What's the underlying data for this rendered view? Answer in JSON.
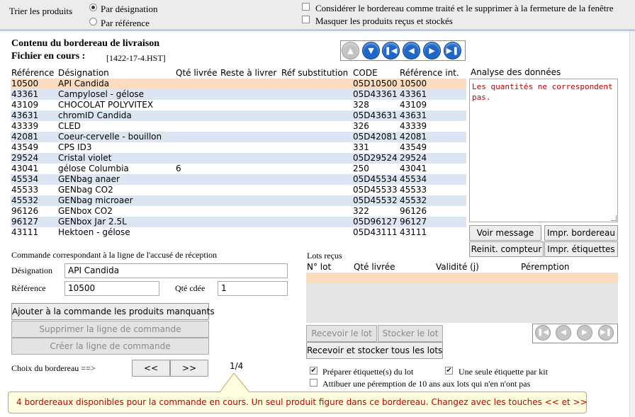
{
  "sort": {
    "label": "Trier les produits",
    "options": [
      {
        "label": "Par désignation",
        "selected": true
      },
      {
        "label": "Par référence",
        "selected": false
      }
    ]
  },
  "options": [
    {
      "label": "Considérer le bordereau comme traité et le supprimer à la fermeture de la fenêtre",
      "checked": false
    },
    {
      "label": "Masquer les produits reçus et stockés",
      "checked": false
    }
  ],
  "slip": {
    "title": "Contenu du bordereau de livraison",
    "file_label": "Fichier en cours :",
    "file_name": "[1422-17-4.HST]"
  },
  "grid": {
    "columns": [
      "Référence",
      "Désignation",
      "Qté livrée",
      "Reste à livrer",
      "Réf substitution",
      "CODE",
      "Référence int."
    ],
    "rows": [
      {
        "ref": "10500",
        "des": "API Candida",
        "qte": "",
        "rst": "",
        "sub": "",
        "code": "05D10500",
        "refi": "10500",
        "selected": true
      },
      {
        "ref": "43361",
        "des": "Campylosel - gélose",
        "qte": "",
        "rst": "",
        "sub": "",
        "code": "05D43361",
        "refi": "43361"
      },
      {
        "ref": "43109",
        "des": "CHOCOLAT POLYVITEX",
        "qte": "",
        "rst": "",
        "sub": "",
        "code": "328",
        "refi": "43109"
      },
      {
        "ref": "43631",
        "des": "chromID Candida",
        "qte": "",
        "rst": "",
        "sub": "",
        "code": "05D43631",
        "refi": "43631"
      },
      {
        "ref": "43339",
        "des": "CLED",
        "qte": "",
        "rst": "",
        "sub": "",
        "code": "326",
        "refi": "43339"
      },
      {
        "ref": "42081",
        "des": "Coeur-cervelle - bouillon",
        "qte": "",
        "rst": "",
        "sub": "",
        "code": "05D42081",
        "refi": "42081"
      },
      {
        "ref": "43549",
        "des": "CPS ID3",
        "qte": "",
        "rst": "",
        "sub": "",
        "code": "331",
        "refi": "43549"
      },
      {
        "ref": "29524",
        "des": "Cristal violet",
        "qte": "",
        "rst": "",
        "sub": "",
        "code": "05D29524",
        "refi": "29524"
      },
      {
        "ref": "43041",
        "des": "gélose Columbia",
        "qte": "6",
        "rst": "",
        "sub": "",
        "code": "250",
        "refi": "43041"
      },
      {
        "ref": "45534",
        "des": "GENbag anaer",
        "qte": "",
        "rst": "",
        "sub": "",
        "code": "05D45534",
        "refi": "45534"
      },
      {
        "ref": "45533",
        "des": "GENbag CO2",
        "qte": "",
        "rst": "",
        "sub": "",
        "code": "05D45533",
        "refi": "45533"
      },
      {
        "ref": "45532",
        "des": "GENbag microaer",
        "qte": "",
        "rst": "",
        "sub": "",
        "code": "05D45532",
        "refi": "45532"
      },
      {
        "ref": "96126",
        "des": "GENbox CO2",
        "qte": "",
        "rst": "",
        "sub": "",
        "code": "322",
        "refi": "96126"
      },
      {
        "ref": "96127",
        "des": "GENbox Jar 2.5L",
        "qte": "",
        "rst": "",
        "sub": "",
        "code": "05D96127",
        "refi": "96127"
      },
      {
        "ref": "43111",
        "des": "Hektoen - gélose",
        "qte": "",
        "rst": "",
        "sub": "",
        "code": "05D43111",
        "refi": "43111"
      }
    ]
  },
  "analysis": {
    "title": "Analyse des données",
    "text": "Les quantités ne correspondent pas."
  },
  "right_buttons": {
    "show_message": "Voir message",
    "print_slip": "Impr. bordereau",
    "reset_counter": "Reinit. compteur",
    "print_labels": "Impr. étiquettes"
  },
  "order": {
    "title": "Commande correspondant à la ligne de l'accusé de réception",
    "designation_label": "Désignation",
    "designation_value": "API Candida",
    "reference_label": "Référence",
    "reference_value": "10500",
    "qty_label": "Qté cdée",
    "qty_value": "1",
    "add_missing": "Ajouter à la commande les produits manquants",
    "delete_line": "Supprimer la ligne de commande",
    "create_line": "Créer la ligne de commande"
  },
  "slip_choice": {
    "label": "Choix du bordereau ==>",
    "prev": "<<",
    "next": ">>",
    "page": "1/4"
  },
  "lots": {
    "title": "Lots reçus",
    "columns": [
      "N° lot",
      "Qté livrée",
      "Validité (j)",
      "Péremption"
    ],
    "receive_lot": "Recevoir le lot",
    "store_lot": "Stocker le lot",
    "receive_store_all": "Recevoir et stocker tous les lots"
  },
  "label_options": [
    {
      "label": "Préparer étiquette(s) du lot",
      "checked": true
    },
    {
      "label": "Une seule étiquette par kit",
      "checked": true
    },
    {
      "label": "Attibuer une péremption de 10 ans aux lots qui n'en n'ont pas",
      "checked": false
    }
  ],
  "tooltip": {
    "text": "4 bordereaux disponibles pour la commande en cours. Un seul produit figure dans ce bordereau. Changez avec les touches << et >>"
  },
  "colors": {
    "row_selected": "#fbdcbf",
    "row_alt": "#dbe6f2",
    "nav_button": "#1c67c9",
    "error_text": "#c00000",
    "top_bar": "#ececec"
  }
}
